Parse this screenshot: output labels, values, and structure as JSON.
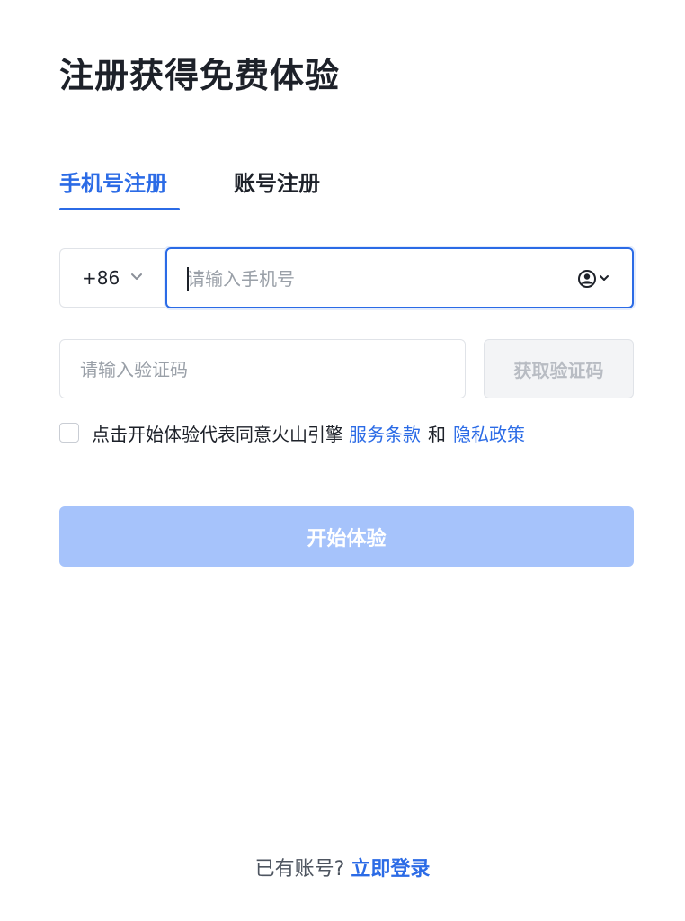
{
  "title": "注册获得免费体验",
  "tabs": {
    "phone": "手机号注册",
    "account": "账号注册",
    "active": "phone"
  },
  "phone": {
    "country_code": "+86",
    "placeholder": "请输入手机号",
    "value": ""
  },
  "code": {
    "placeholder": "请输入验证码",
    "value": "",
    "get_code_label": "获取验证码"
  },
  "agreement": {
    "checked": false,
    "text": "点击开始体验代表同意火山引擎",
    "terms_label": "服务条款",
    "and_label": "和",
    "privacy_label": "隐私政策"
  },
  "submit_label": "开始体验",
  "footer": {
    "question": "已有账号?",
    "login_label": "立即登录"
  },
  "colors": {
    "accent": "#2b6be6",
    "button_disabled": "#a6c3fb"
  },
  "icons": {
    "country_dropdown": "chevron-down-icon",
    "contact": "contact-picker-icon"
  }
}
